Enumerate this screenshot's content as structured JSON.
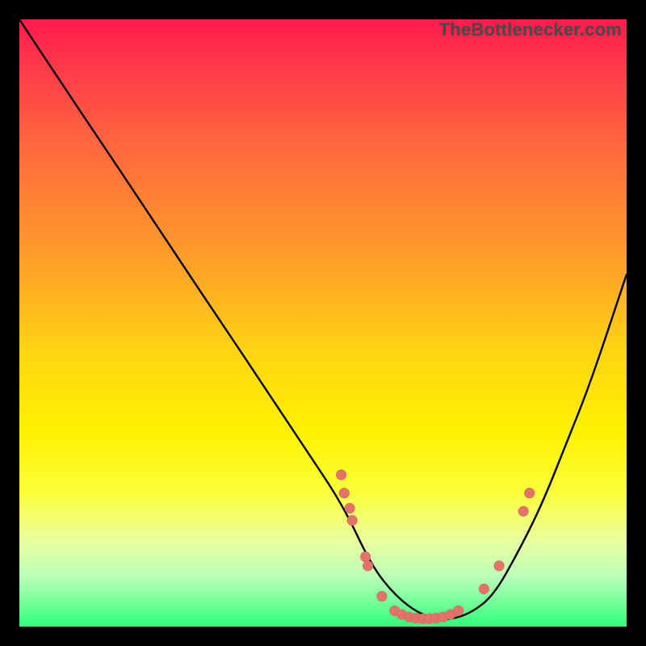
{
  "watermark": {
    "text": "TheBottlenecker.com"
  },
  "colors": {
    "gradient_top": "#ff1a4d",
    "gradient_bottom": "#2eff7a",
    "curve": "#000000",
    "dot": "#e5716b",
    "background": "#000000"
  },
  "chart_data": {
    "type": "line",
    "title": "",
    "xlabel": "",
    "ylabel": "",
    "xlim": [
      0,
      100
    ],
    "ylim": [
      0,
      100
    ],
    "series": [
      {
        "name": "bottleneck-curve",
        "x": [
          0,
          6.6,
          13.3,
          20,
          26.6,
          33.3,
          40,
          46.6,
          53.3,
          58,
          62,
          66,
          70,
          74,
          78,
          82,
          86,
          90,
          94,
          100
        ],
        "y": [
          100,
          90,
          80,
          70,
          60,
          50,
          40,
          30,
          20,
          10,
          5,
          2,
          1,
          2,
          5,
          12,
          20,
          30,
          40,
          58
        ]
      }
    ],
    "points": [
      {
        "x": 53.0,
        "y": 25.0
      },
      {
        "x": 53.5,
        "y": 22.0
      },
      {
        "x": 54.4,
        "y": 19.5
      },
      {
        "x": 54.8,
        "y": 17.5
      },
      {
        "x": 57.0,
        "y": 11.5
      },
      {
        "x": 57.4,
        "y": 10.0
      },
      {
        "x": 59.7,
        "y": 5.0
      },
      {
        "x": 61.8,
        "y": 2.6
      },
      {
        "x": 63.0,
        "y": 2.0
      },
      {
        "x": 64.2,
        "y": 1.6
      },
      {
        "x": 65.3,
        "y": 1.4
      },
      {
        "x": 66.4,
        "y": 1.3
      },
      {
        "x": 67.5,
        "y": 1.3
      },
      {
        "x": 68.6,
        "y": 1.4
      },
      {
        "x": 69.8,
        "y": 1.6
      },
      {
        "x": 71.0,
        "y": 2.0
      },
      {
        "x": 72.3,
        "y": 2.6
      },
      {
        "x": 76.5,
        "y": 6.2
      },
      {
        "x": 79.0,
        "y": 10.0
      },
      {
        "x": 83.0,
        "y": 19.0
      },
      {
        "x": 84.0,
        "y": 22.0
      }
    ],
    "note": "Axes have no visible tick labels; x and y normalized 0–100. y=0 is bottom (green), y=100 is top (red)."
  }
}
